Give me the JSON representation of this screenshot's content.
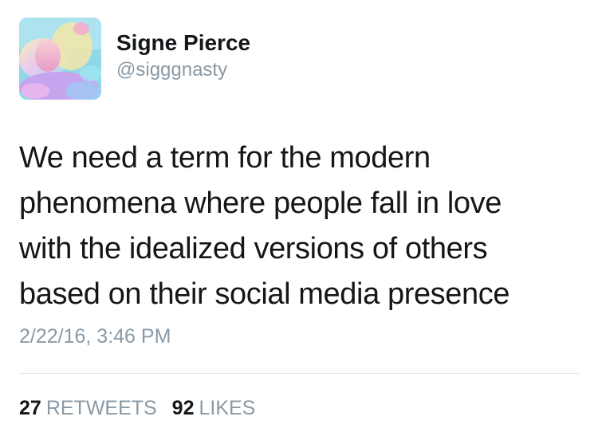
{
  "author": {
    "name": "Signe Pierce",
    "handle": "@sigggnasty"
  },
  "tweet": {
    "lines": [
      "We need a term for the modern",
      "phenomena where people fall in love",
      "with the idealized versions of others",
      "based on their social media presence"
    ],
    "timestamp": "2/22/16, 3:46 PM"
  },
  "stats": {
    "retweets_count": "27",
    "retweets_label": "RETWEETS",
    "likes_count": "92",
    "likes_label": "LIKES"
  },
  "colors": {
    "text": "#14171a",
    "secondary": "#8899a6",
    "divider": "#e1e8ed"
  }
}
